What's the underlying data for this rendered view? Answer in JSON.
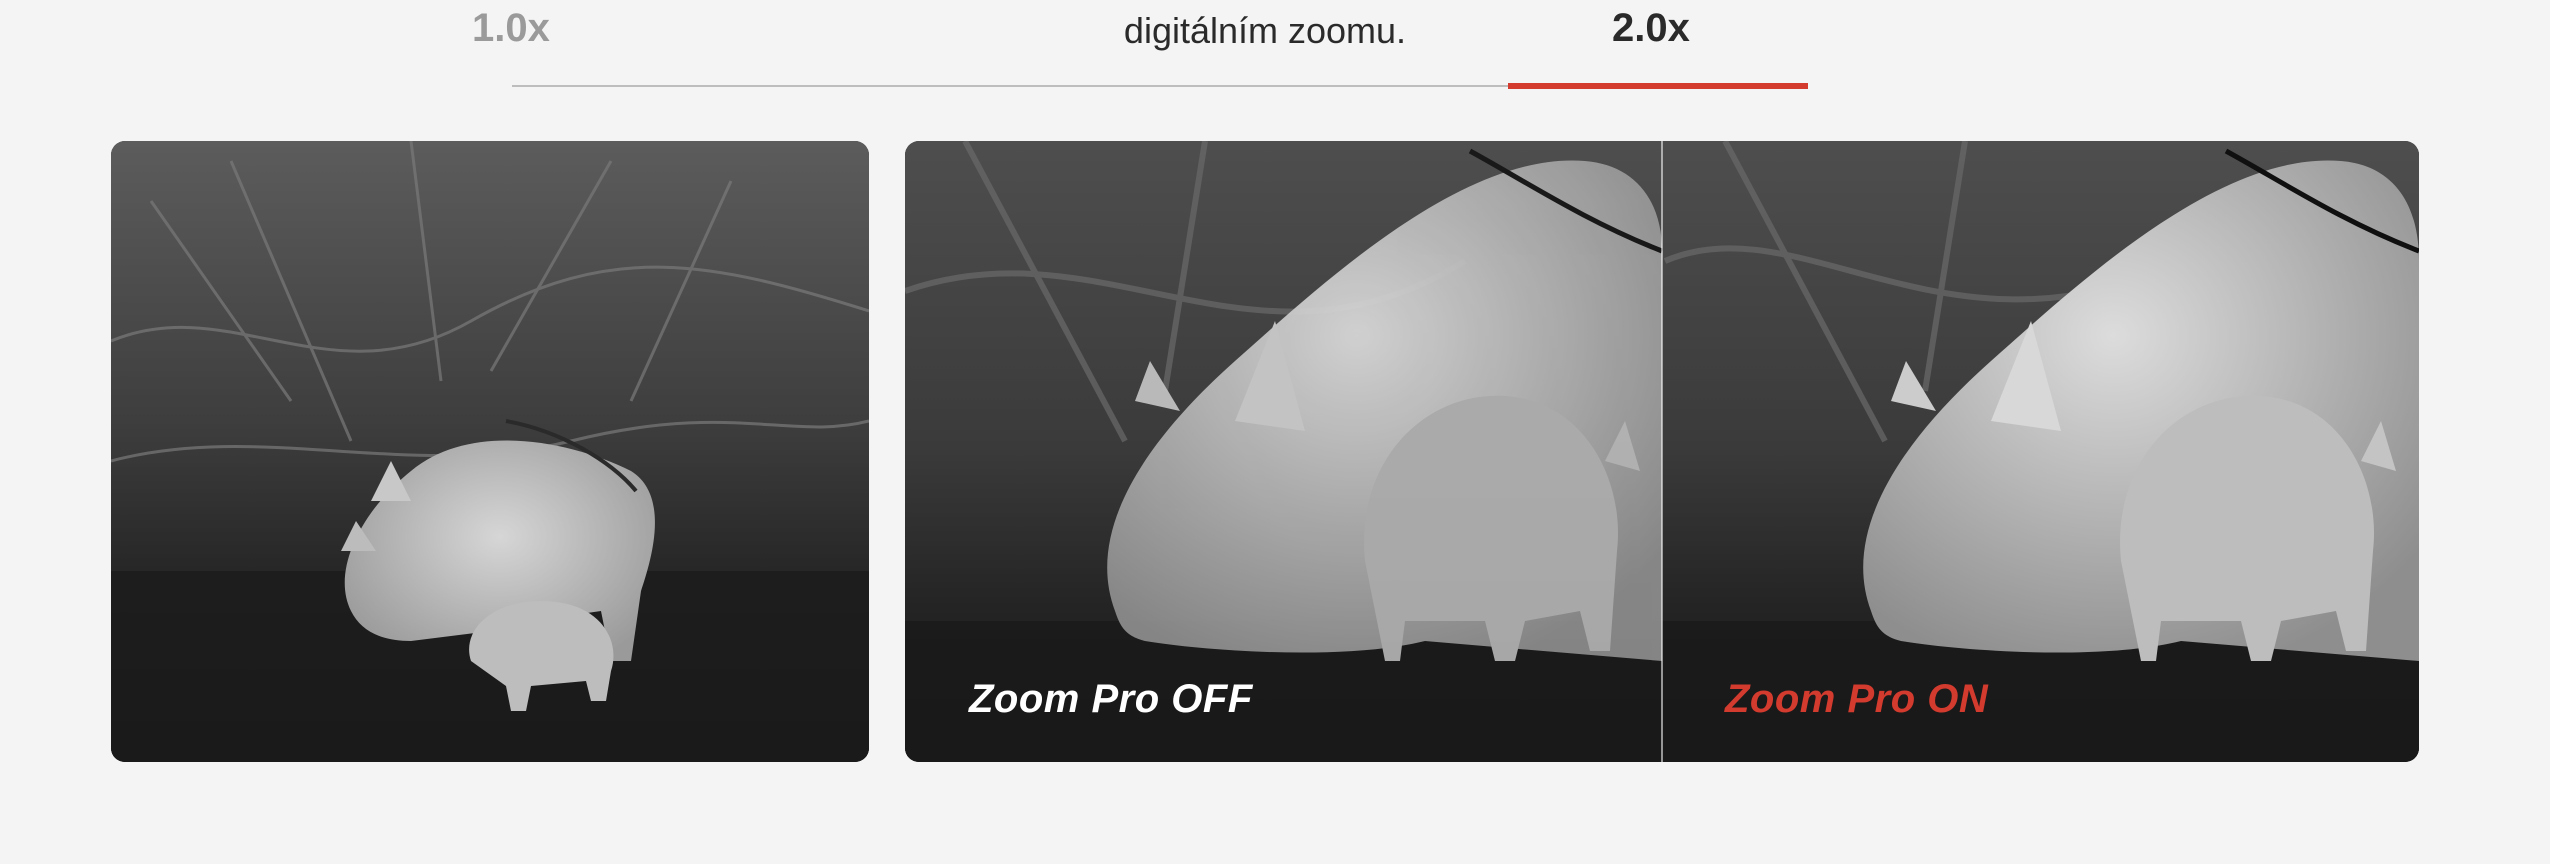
{
  "tabs": [
    {
      "label": "1.0x",
      "active": false
    },
    {
      "label": "2.0x",
      "active": true
    }
  ],
  "caption": "digitálním zoomu.",
  "comparison": {
    "left_label": "Zoom Pro OFF",
    "right_label": "Zoom Pro ON"
  },
  "colors": {
    "accent": "#d23b2e",
    "background": "#f4f4f4",
    "text": "#2a2a2a",
    "muted": "#9a9a9a"
  }
}
